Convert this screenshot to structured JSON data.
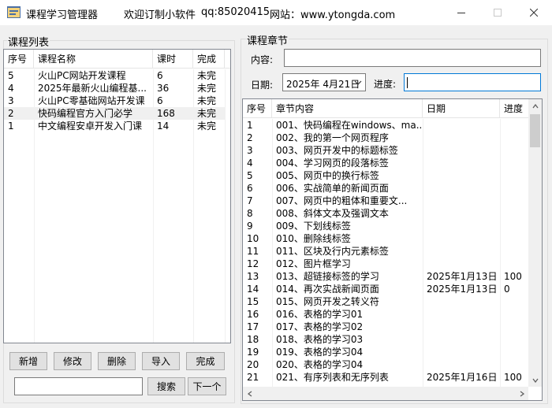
{
  "window": {
    "title": "课程学习管理器",
    "subtitle": "欢迎订制小软件",
    "qq": "qq:85020415",
    "website": "网站：www.ytongda.com"
  },
  "course_panel": {
    "group_label": "课程列表",
    "columns": [
      "序号",
      "课程名称",
      "课时",
      "完成"
    ],
    "rows": [
      [
        "5",
        "火山PC网站开发课程",
        "6",
        "未完"
      ],
      [
        "4",
        "2025年最新火山编程基...",
        "36",
        "未完"
      ],
      [
        "3",
        "火山PC零基础网站开发课",
        "6",
        "未完"
      ],
      [
        "2",
        "快码编程官方入门必学",
        "168",
        "未完"
      ],
      [
        "1",
        "中文编程安卓开发入门课",
        "14",
        "未完"
      ]
    ],
    "buttons": {
      "add": "新增",
      "edit": "修改",
      "delete": "删除",
      "import": "导入",
      "complete": "完成",
      "search": "搜索",
      "next": "下一个"
    },
    "search_value": ""
  },
  "chapter_panel": {
    "group_label": "课程章节",
    "content_label": "内容:",
    "content_value": "",
    "date_label": "日期:",
    "date_value": "2025年 4月21日",
    "progress_label": "进度:",
    "progress_value": "",
    "columns": [
      "序号",
      "章节内容",
      "日期",
      "进度"
    ],
    "rows": [
      [
        "1",
        "001、快码编程在windows、ma...",
        "",
        ""
      ],
      [
        "2",
        "002、我的第一个网页程序",
        "",
        ""
      ],
      [
        "3",
        "003、网页开发中的标题标签",
        "",
        ""
      ],
      [
        "4",
        "004、学习网页的段落标签",
        "",
        ""
      ],
      [
        "5",
        "005、网页中的换行标签",
        "",
        ""
      ],
      [
        "6",
        "006、实战简单的新闻页面",
        "",
        ""
      ],
      [
        "7",
        "007、网页中的粗体和重要文...",
        "",
        ""
      ],
      [
        "8",
        "008、斜体文本及强调文本",
        "",
        ""
      ],
      [
        "9",
        "009、下划线标签",
        "",
        ""
      ],
      [
        "10",
        "010、删除线标签",
        "",
        ""
      ],
      [
        "11",
        "011、区块及行内元素标签",
        "",
        ""
      ],
      [
        "12",
        "012、图片框学习",
        "",
        ""
      ],
      [
        "13",
        "013、超链接标签的学习",
        "2025年1月13日",
        "100"
      ],
      [
        "14",
        "014、再次实战新闻页面",
        "2025年1月13日",
        "0"
      ],
      [
        "15",
        "015、网页开发之转义符",
        "",
        ""
      ],
      [
        "16",
        "016、表格的学习01",
        "",
        ""
      ],
      [
        "17",
        "017、表格的学习02",
        "",
        ""
      ],
      [
        "18",
        "018、表格的学习03",
        "",
        ""
      ],
      [
        "19",
        "019、表格的学习04",
        "",
        ""
      ],
      [
        "20",
        "020、表格的学习04",
        "",
        ""
      ],
      [
        "21",
        "021、有序列表和无序列表",
        "2025年1月16日",
        "100"
      ]
    ]
  },
  "icons": {
    "app": "app-icon",
    "minimize": "minimize-icon",
    "maximize": "maximize-icon",
    "close": "close-icon",
    "dropdown": "chevron-down-icon"
  },
  "colors": {
    "selection": "#f0f0f0",
    "focus_border": "#0078d7",
    "scroll_thumb": "#cdcdcd"
  }
}
